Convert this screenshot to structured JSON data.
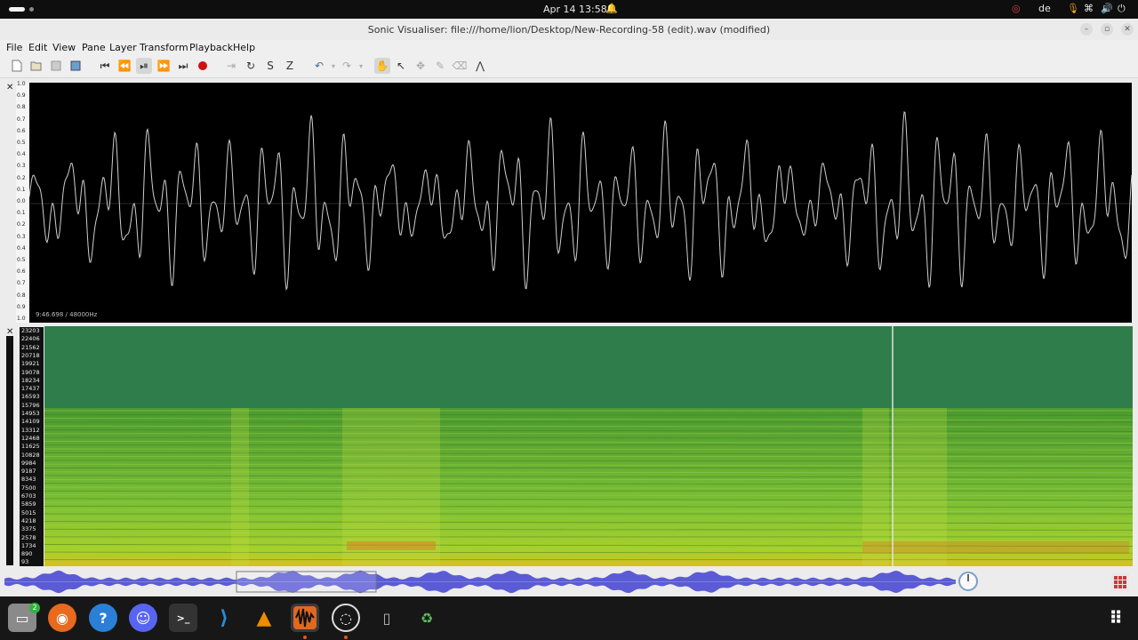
{
  "topbar": {
    "clock": "Apr 14  13:58",
    "keyboard_layout": "de"
  },
  "window": {
    "title": "Sonic Visualiser: file:///home/lion/Desktop/New-Recording-58 (edit).wav (modified)"
  },
  "menu": {
    "items": [
      "File",
      "Edit",
      "View",
      "Pane",
      "Layer",
      "Transform",
      "Playback",
      "Help"
    ]
  },
  "waveform_pane": {
    "info": "9:46.698 / 48000Hz",
    "scale_labels": [
      "1.0",
      "0.9",
      "0.8",
      "0.7",
      "0.6",
      "0.5",
      "0.4",
      "0.3",
      "0.2",
      "0.1",
      "0.0",
      "0.1",
      "0.2",
      "0.3",
      "0.4",
      "0.5",
      "0.6",
      "0.7",
      "0.8",
      "0.9",
      "1.0"
    ],
    "wave_color": "#cfcfcf"
  },
  "spectrogram_pane": {
    "freq_labels": [
      "23203",
      "22406",
      "21562",
      "20718",
      "19921",
      "19078",
      "18234",
      "17437",
      "16593",
      "15796",
      "14953",
      "14109",
      "13312",
      "12468",
      "11625",
      "10828",
      "9984",
      "9187",
      "8343",
      "7500",
      "6703",
      "5859",
      "5015",
      "4218",
      "3375",
      "2578",
      "1734",
      "890",
      "93"
    ],
    "top_color": "#2f7d4a",
    "body_color": "#6fb63a"
  },
  "overview": {
    "wave_color": "#5b5bd6"
  },
  "dock": {
    "files_badge": "2"
  },
  "colors": {
    "accent": "#e95420",
    "record": "#d01010"
  }
}
